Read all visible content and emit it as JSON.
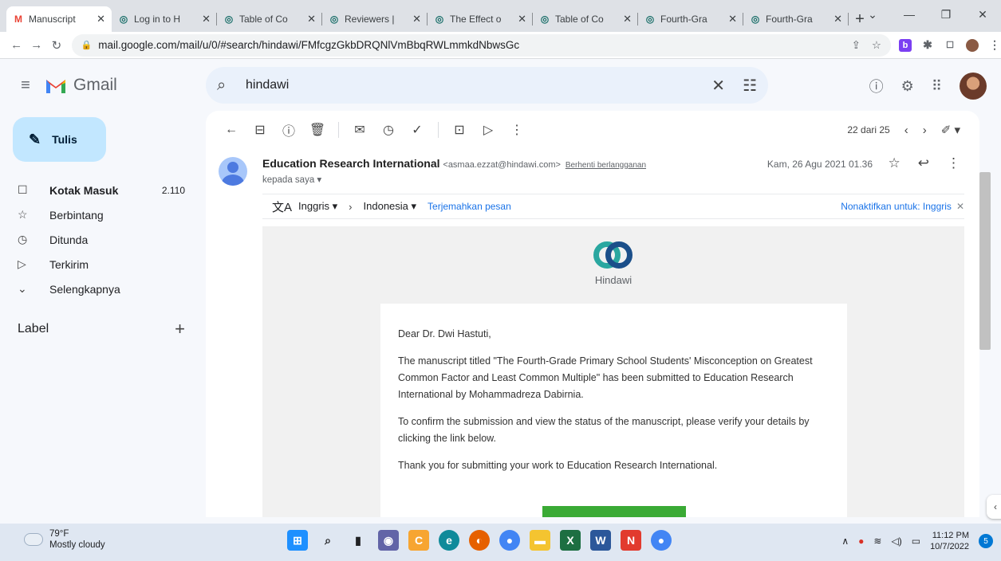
{
  "browser": {
    "tabs": [
      {
        "title": "Manuscript",
        "favicon": "gmail-icon"
      },
      {
        "title": "Log in to H",
        "favicon": "hindawi-icon"
      },
      {
        "title": "Table of Co",
        "favicon": "hindawi-icon"
      },
      {
        "title": "Reviewers |",
        "favicon": "hindawi-icon"
      },
      {
        "title": "The Effect o",
        "favicon": "hindawi-icon"
      },
      {
        "title": "Table of Co",
        "favicon": "hindawi-icon"
      },
      {
        "title": "Fourth-Gra",
        "favicon": "hindawi-icon"
      },
      {
        "title": "Fourth-Gra",
        "favicon": "hindawi-icon"
      }
    ],
    "url": "mail.google.com/mail/u/0/#search/hindawi/FMfcgzGkbDRQNlVmBbqRWLmmkdNbwsGc"
  },
  "gmail": {
    "app_name": "Gmail",
    "search_value": "hindawi",
    "compose_label": "Tulis",
    "nav": [
      {
        "label": "Kotak Masuk",
        "count": "2.110",
        "icon": "inbox-icon",
        "glyph": "☐",
        "bold": true
      },
      {
        "label": "Berbintang",
        "count": "",
        "icon": "star-icon",
        "glyph": "☆",
        "bold": false
      },
      {
        "label": "Ditunda",
        "count": "",
        "icon": "clock-icon",
        "glyph": "◷",
        "bold": false
      },
      {
        "label": "Terkirim",
        "count": "",
        "icon": "send-icon",
        "glyph": "▷",
        "bold": false
      },
      {
        "label": "Selengkapnya",
        "count": "",
        "icon": "chevron-down-icon",
        "glyph": "⌄",
        "bold": false
      }
    ],
    "labels_heading": "Label",
    "pager_text": "22 dari 25"
  },
  "message": {
    "sender_name": "Education Research International",
    "sender_email": "<asmaa.ezzat@hindawi.com>",
    "unsubscribe": "Berhenti berlangganan",
    "to": "kepada saya ▾",
    "date": "Kam, 26 Agu 2021 01.36",
    "translate": {
      "from": "Inggris ▾",
      "to": "Indonesia ▾",
      "link": "Terjemahkan pesan",
      "disable": "Nonaktifkan untuk: Inggris"
    },
    "logo_text": "Hindawi",
    "greeting": "Dear Dr. Dwi Hastuti,",
    "para1": "The manuscript titled \"The Fourth-Grade Primary School Students' Misconception on Greatest Common Factor and Least Common Multiple\" has been submitted to Education Research International by Mohammadreza Dabirnia.",
    "para2": "To confirm the submission and view the status of the manuscript, please verify your details by clicking the link below.",
    "para3": "Thank you for submitting your work to Education Research International."
  },
  "taskbar": {
    "temperature": "79°F",
    "weather": "Mostly cloudy",
    "time": "11:12 PM",
    "date": "10/7/2022",
    "notification_count": "5"
  },
  "colors": {
    "gmail_red": "#ea4335",
    "compose_bg": "#c2e7ff",
    "search_bg": "#eaf1fb",
    "link_blue": "#1a73e8",
    "cta_green": "#3aaa35"
  }
}
